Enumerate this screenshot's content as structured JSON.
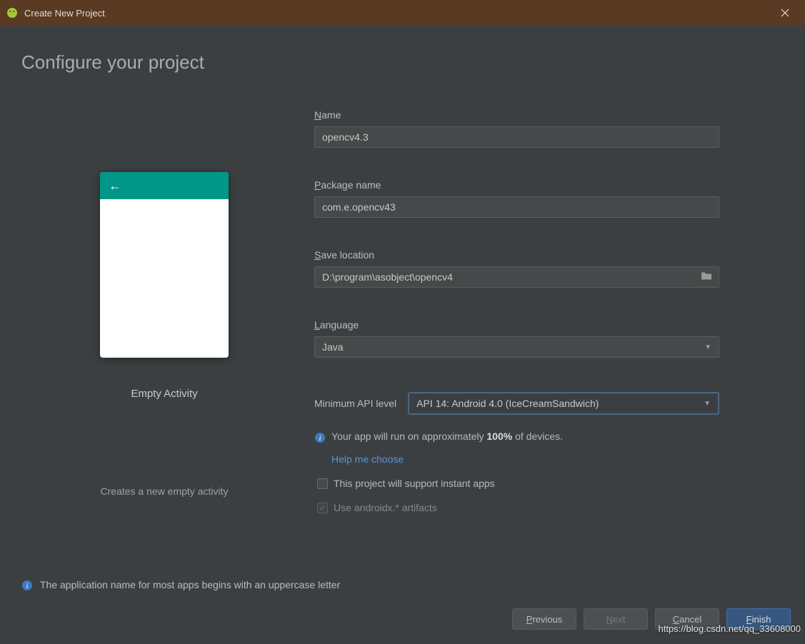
{
  "window": {
    "title": "Create New Project"
  },
  "heading": "Configure your project",
  "preview": {
    "template_name": "Empty Activity",
    "template_desc": "Creates a new empty activity"
  },
  "form": {
    "name_label_ul": "N",
    "name_label_rest": "ame",
    "name_value": "opencv4.3",
    "pkg_label_ul": "P",
    "pkg_label_rest": "ackage name",
    "pkg_value": "com.e.opencv43",
    "save_label_ul": "S",
    "save_label_rest": "ave location",
    "save_value": "D:\\program\\asobject\\opencv4",
    "lang_label_ul": "L",
    "lang_label_rest": "anguage",
    "lang_value": "Java",
    "api_label": "Minimum API level",
    "api_value": "API 14: Android 4.0 (IceCreamSandwich)",
    "info_text_pre": "Your app will run on approximately ",
    "info_text_bold": "100%",
    "info_text_post": " of devices.",
    "help_link": "Help me choose",
    "instant_apps_label": "This project will support instant apps",
    "androidx_label": "Use androidx.* artifacts"
  },
  "bottom_info": "The application name for most apps begins with an uppercase letter",
  "buttons": {
    "previous_ul": "P",
    "previous_rest": "revious",
    "next_ul": "N",
    "next_rest": "ext",
    "cancel_ul": "C",
    "cancel_rest": "ancel",
    "finish_ul": "F",
    "finish_rest": "inish"
  },
  "watermark": "https://blog.csdn.net/qq_33608000"
}
